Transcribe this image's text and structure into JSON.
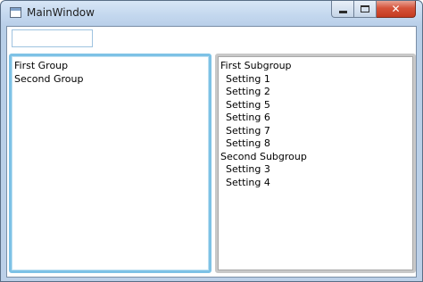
{
  "window": {
    "title": "MainWindow"
  },
  "search": {
    "value": ""
  },
  "groups": [
    {
      "label": "First Group"
    },
    {
      "label": "Second Group"
    }
  ],
  "subgroups": [
    {
      "label": "First Subgroup",
      "indent": false
    },
    {
      "label": "Setting 1",
      "indent": true
    },
    {
      "label": "Setting 2",
      "indent": true
    },
    {
      "label": "Setting 5",
      "indent": true
    },
    {
      "label": "Setting 6",
      "indent": true
    },
    {
      "label": "Setting 7",
      "indent": true
    },
    {
      "label": "Setting 8",
      "indent": true
    },
    {
      "label": "Second Subgroup",
      "indent": false
    },
    {
      "label": "Setting 3",
      "indent": true
    },
    {
      "label": "Setting 4",
      "indent": true
    }
  ],
  "colors": {
    "focus_border": "#7dc2e6",
    "close_button": "#c43a20"
  }
}
